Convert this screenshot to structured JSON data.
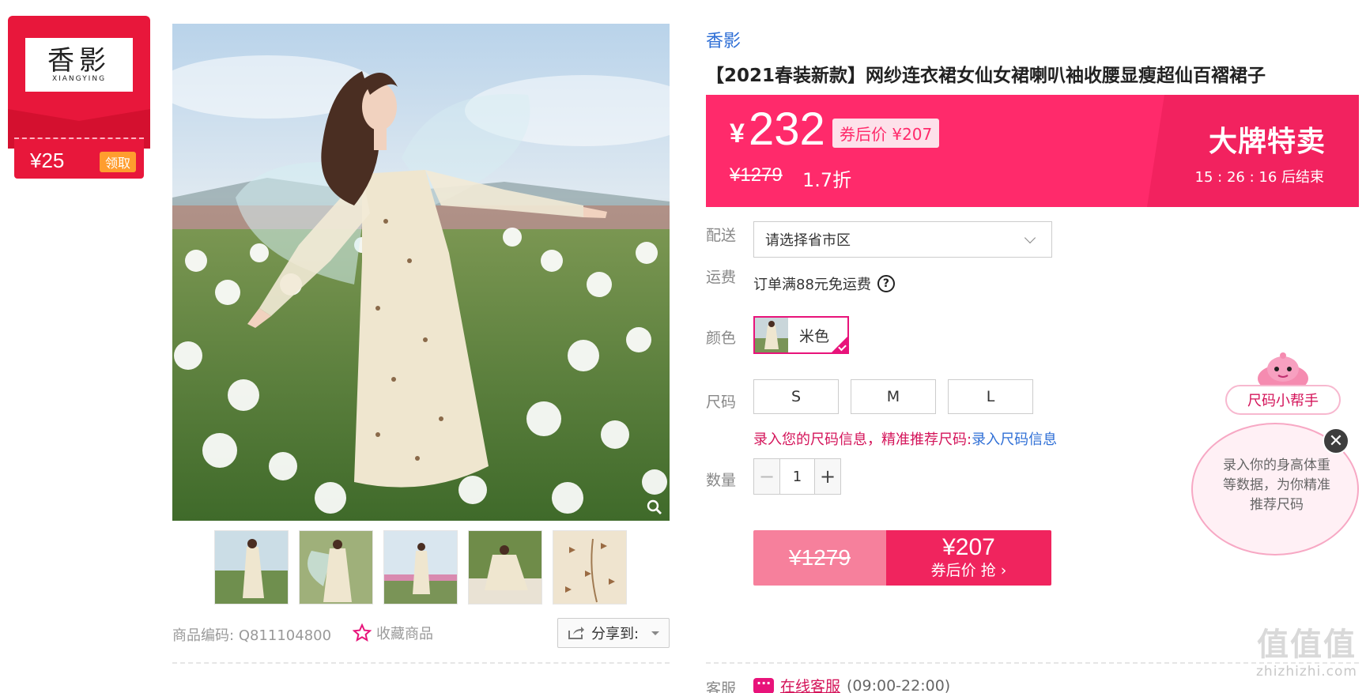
{
  "coupon": {
    "logo_cn": "香影",
    "logo_en": "XIANGYING",
    "amount": "¥25",
    "claim_label": "领取"
  },
  "product": {
    "brand": "香影",
    "title": "【2021春装新款】网纱连衣裙女仙女裙喇叭袖收腰显瘦超仙百褶裙子",
    "sku_label": "商品编码:",
    "sku_value": "Q811104800",
    "favorite_label": "收藏商品",
    "share_label": "分享到:"
  },
  "price_banner": {
    "currency": "¥",
    "price": "232",
    "coupon_price": "券后价 ¥207",
    "original_price": "¥1279",
    "discount": "1.7折",
    "sale_title": "大牌特卖",
    "countdown": "15 : 26 : 16  后结束"
  },
  "labels": {
    "shipping": "配送",
    "freight": "运费",
    "color": "颜色",
    "size": "尺码",
    "quantity": "数量",
    "service": "客服"
  },
  "shipping": {
    "placeholder": "请选择省市区"
  },
  "freight": {
    "text": "订单满88元免运费",
    "help": "?"
  },
  "colors": [
    {
      "name": "米色",
      "selected": true
    }
  ],
  "sizes": [
    "S",
    "M",
    "L"
  ],
  "size_hint": {
    "text": "录入您的尺码信息，精准推荐尺码:",
    "link": "录入尺码信息"
  },
  "quantity": {
    "minus": "−",
    "value": "1",
    "plus": "+"
  },
  "buy_button": {
    "original": "¥1279",
    "price": "¥207",
    "action": "券后价 抢 ›"
  },
  "service": {
    "link": "在线客服",
    "hours": "(09:00-22:00)"
  },
  "size_helper": {
    "title": "尺码小帮手",
    "text": "录入你的身高体重等数据，为你精准推荐尺码",
    "close": "✕"
  },
  "watermark": {
    "main": "值值值",
    "sub": "zhizhizhi.com"
  },
  "colors_theme": {
    "accent": "#ff2a6b",
    "coupon_red": "#e8173b",
    "link_blue": "#2f6fd6"
  }
}
